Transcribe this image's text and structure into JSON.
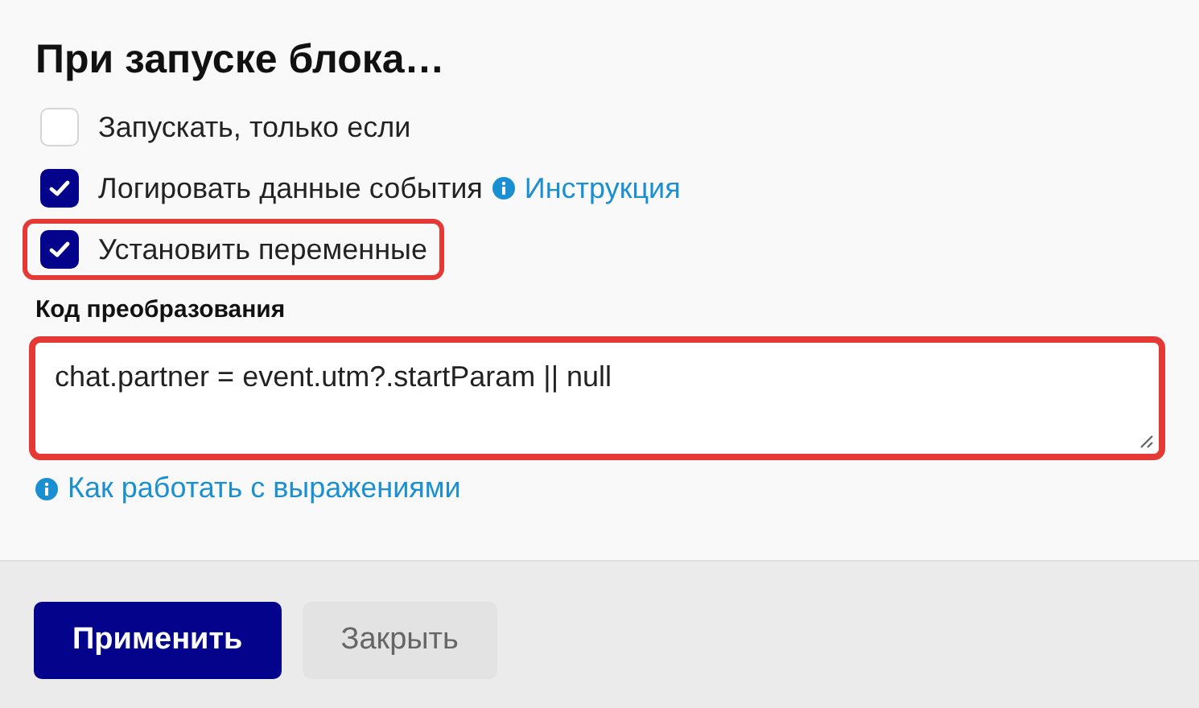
{
  "title": "При запуске блока…",
  "options": [
    {
      "label": "Запускать, только если",
      "checked": false,
      "highlighted": false
    },
    {
      "label": "Логировать данные события",
      "checked": true,
      "highlighted": false,
      "link": "Инструкция"
    },
    {
      "label": "Установить переменные",
      "checked": true,
      "highlighted": true
    }
  ],
  "code_field": {
    "label": "Код преобразования",
    "value": "chat.partner = event.utm?.startParam || null",
    "highlighted": true
  },
  "help_link": "Как работать с выражениями",
  "buttons": [
    {
      "label": "Применить",
      "kind": "primary"
    },
    {
      "label": "Закрыть",
      "kind": "secondary"
    }
  ]
}
